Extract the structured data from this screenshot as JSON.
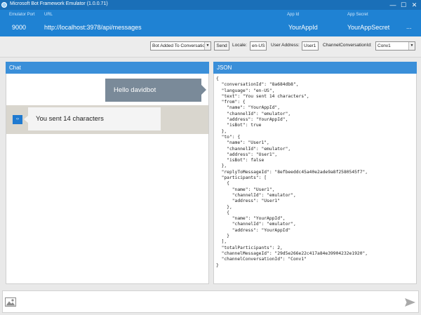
{
  "window": {
    "title": "Microsoft Bot Framework Emulator (1.0.0.71)",
    "controls": {
      "minimize": "—",
      "maximize": "☐",
      "close": "✕"
    }
  },
  "header": {
    "emulator_port_label": "Emulator Port",
    "url_label": "URL",
    "app_id_label": "App Id",
    "app_secret_label": "App Secret",
    "port": "9000",
    "url": "http://localhost:3978/api/messages",
    "app_id": "YourAppId",
    "app_secret": "YourAppSecret",
    "more": "..."
  },
  "toolbar": {
    "activity_type": "Bot Added To Conversatio",
    "send_label": "Send",
    "locale_label": "Locale:",
    "locale_value": "en-US",
    "user_address_label": "User Address:",
    "user_address_value": "User1",
    "channel_conversation_label": "ChannelConversationId:",
    "channel_conversation_value": "Conv1"
  },
  "chat": {
    "title": "Chat",
    "outgoing_message": "Hello davidbot",
    "incoming_message": "You sent 14 characters",
    "bot_avatar_glyph": "‹›"
  },
  "json_panel": {
    "title": "JSON",
    "content": "{\n  \"conversationId\": \"8a684db8\",\n  \"language\": \"en-US\",\n  \"text\": \"You sent 14 characters\",\n  \"from\": {\n    \"name\": \"YourAppId\",\n    \"channelId\": \"emulator\",\n    \"address\": \"YourAppId\",\n    \"isBot\": true\n  },\n  \"to\": {\n    \"name\": \"User1\",\n    \"channelId\": \"emulator\",\n    \"address\": \"User1\",\n    \"isBot\": false\n  },\n  \"replyToMessageId\": \"8efbeeddc45a40e2ade9a8f2580545f7\",\n  \"participants\": [\n    {\n      \"name\": \"User1\",\n      \"channelId\": \"emulator\",\n      \"address\": \"User1\"\n    },\n    {\n      \"name\": \"YourAppId\",\n      \"channelId\": \"emulator\",\n      \"address\": \"YourAppId\"\n    }\n  ],\n  \"totalParticipants\": 2,\n  \"channelMessageId\": \"29d5e266e22c417a84e39904232e1920\",\n  \"channelConversationId\": \"Conv1\"\n}"
  },
  "compose": {
    "image_icon": "image-icon",
    "send_icon": "send-icon"
  },
  "colors": {
    "title_bar": "#1a6fb8",
    "header_bar": "#1f82d3",
    "panel_header": "#3a8fd9",
    "outgoing_bubble": "#7a8a99",
    "incoming_row": "#d9d6ce"
  }
}
